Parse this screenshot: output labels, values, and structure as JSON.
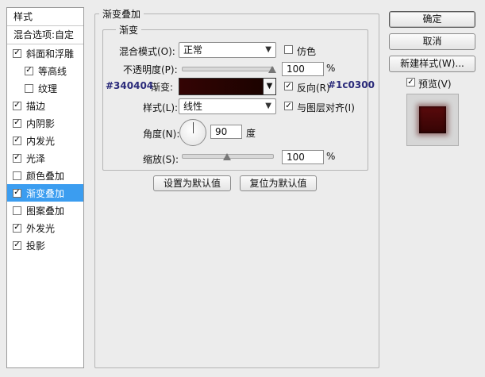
{
  "sidebar": {
    "header": "样式",
    "blending_options": "混合选项:自定",
    "items": [
      {
        "label": "斜面和浮雕",
        "checked": true,
        "sub": false,
        "selected": false
      },
      {
        "label": "等高线",
        "checked": true,
        "sub": true,
        "selected": false
      },
      {
        "label": "纹理",
        "checked": false,
        "sub": true,
        "selected": false
      },
      {
        "label": "描边",
        "checked": true,
        "sub": false,
        "selected": false
      },
      {
        "label": "内阴影",
        "checked": true,
        "sub": false,
        "selected": false
      },
      {
        "label": "内发光",
        "checked": true,
        "sub": false,
        "selected": false
      },
      {
        "label": "光泽",
        "checked": true,
        "sub": false,
        "selected": false
      },
      {
        "label": "颜色叠加",
        "checked": false,
        "sub": false,
        "selected": false
      },
      {
        "label": "渐变叠加",
        "checked": true,
        "sub": false,
        "selected": true
      },
      {
        "label": "图案叠加",
        "checked": false,
        "sub": false,
        "selected": false
      },
      {
        "label": "外发光",
        "checked": true,
        "sub": false,
        "selected": false
      },
      {
        "label": "投影",
        "checked": true,
        "sub": false,
        "selected": false
      }
    ]
  },
  "panel": {
    "group_title": "渐变叠加",
    "subgroup_title": "渐变",
    "blend_mode_label": "混合模式(O):",
    "blend_mode_value": "正常",
    "dither_label": "仿色",
    "opacity_label": "不透明度(P):",
    "opacity_value": "100",
    "opacity_unit": "%",
    "opacity_level": 1.0,
    "gradient_note_left": "#340404",
    "gradient_label": "渐变:",
    "gradient_note_right": "#1c0300",
    "gradient_colors": {
      "start": "#340404",
      "end": "#1c0300"
    },
    "reverse_label": "反向(R)",
    "style_label": "样式(L):",
    "style_value": "线性",
    "align_label": "与图层对齐(I)",
    "angle_label": "角度(N):",
    "angle_value": "90",
    "angle_unit": "度",
    "scale_label": "缩放(S):",
    "scale_value": "100",
    "scale_unit": "%",
    "scale_level": 0.5,
    "set_default_label": "设置为默认值",
    "reset_default_label": "复位为默认值"
  },
  "right": {
    "ok_label": "确定",
    "cancel_label": "取消",
    "new_style_label": "新建样式(W)...",
    "preview_label": "预览(V)"
  },
  "colors": {
    "selection": "#3b9df0",
    "note_text": "#2a2a7a",
    "preview_fill": "#5a0a0c"
  }
}
